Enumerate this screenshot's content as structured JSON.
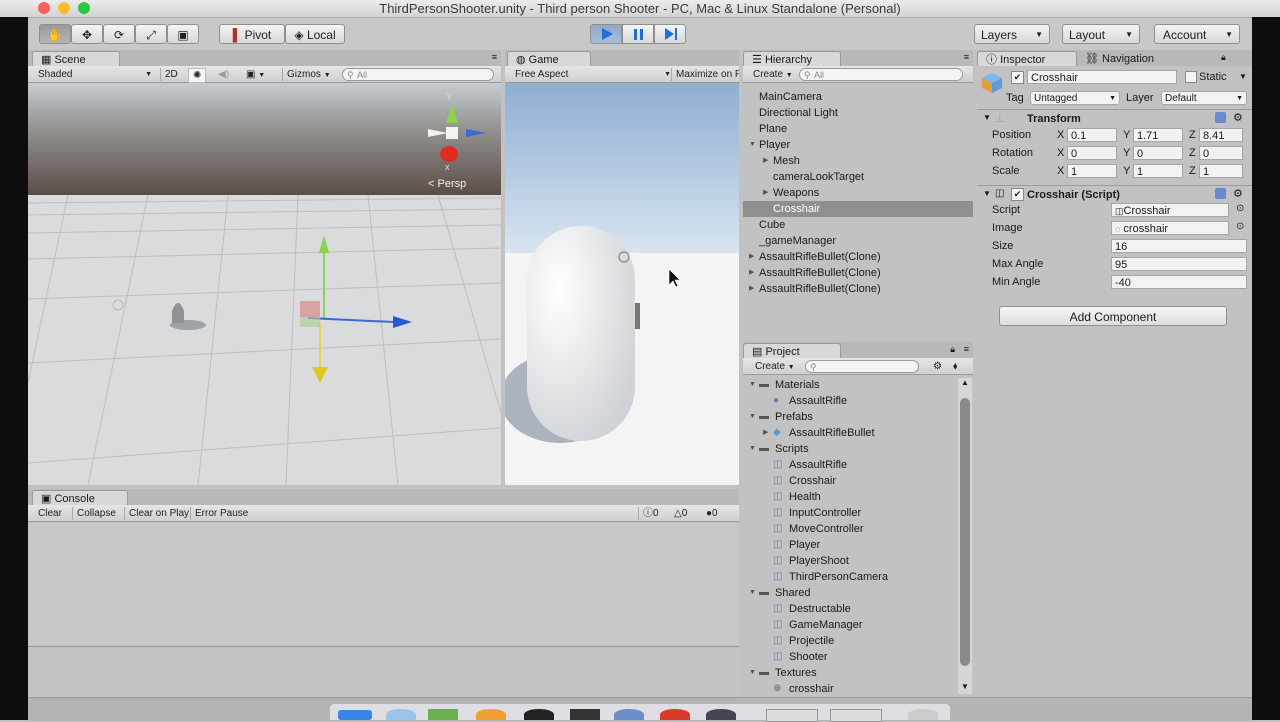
{
  "window": {
    "title": "ThirdPersonShooter.unity - Third person Shooter - PC, Mac & Linux Standalone (Personal)"
  },
  "toolbar": {
    "pivot": "Pivot",
    "local": "Local",
    "layers": "Layers",
    "layout": "Layout",
    "account": "Account"
  },
  "scene": {
    "tab": "Scene",
    "shading": "Shaded",
    "mode2d": "2D",
    "gizmos": "Gizmos",
    "search_placeholder": "All",
    "persp": "Persp",
    "axis_y": "y",
    "axis_x": "x"
  },
  "game": {
    "tab": "Game",
    "aspect": "Free Aspect",
    "maximize": "Maximize on P"
  },
  "hierarchy": {
    "tab": "Hierarchy",
    "create": "Create",
    "search_placeholder": "All",
    "items": [
      {
        "label": "MainCamera",
        "indent": 0,
        "arrow": ""
      },
      {
        "label": "Directional Light",
        "indent": 0,
        "arrow": ""
      },
      {
        "label": "Plane",
        "indent": 0,
        "arrow": ""
      },
      {
        "label": "Player",
        "indent": 0,
        "arrow": "open"
      },
      {
        "label": "Mesh",
        "indent": 1,
        "arrow": "closed"
      },
      {
        "label": "cameraLookTarget",
        "indent": 1,
        "arrow": ""
      },
      {
        "label": "Weapons",
        "indent": 1,
        "arrow": "closed"
      },
      {
        "label": "Crosshair",
        "indent": 1,
        "arrow": "",
        "selected": true
      },
      {
        "label": "Cube",
        "indent": 0,
        "arrow": ""
      },
      {
        "label": "_gameManager",
        "indent": 0,
        "arrow": ""
      },
      {
        "label": "AssaultRifleBullet(Clone)",
        "indent": 0,
        "arrow": "closed"
      },
      {
        "label": "AssaultRifleBullet(Clone)",
        "indent": 0,
        "arrow": "closed"
      },
      {
        "label": "AssaultRifleBullet(Clone)",
        "indent": 0,
        "arrow": "closed"
      }
    ]
  },
  "project": {
    "tab": "Project",
    "create": "Create",
    "items": [
      {
        "label": "Materials",
        "kind": "folder"
      },
      {
        "label": "AssaultRifle",
        "kind": "material"
      },
      {
        "label": "Prefabs",
        "kind": "folder"
      },
      {
        "label": "AssaultRifleBullet",
        "kind": "prefab"
      },
      {
        "label": "Scripts",
        "kind": "folder"
      },
      {
        "label": "AssaultRifle",
        "kind": "script"
      },
      {
        "label": "Crosshair",
        "kind": "script"
      },
      {
        "label": "Health",
        "kind": "script"
      },
      {
        "label": "InputController",
        "kind": "script"
      },
      {
        "label": "MoveController",
        "kind": "script"
      },
      {
        "label": "Player",
        "kind": "script"
      },
      {
        "label": "PlayerShoot",
        "kind": "script"
      },
      {
        "label": "ThirdPersonCamera",
        "kind": "script"
      },
      {
        "label": "Shared",
        "kind": "folder"
      },
      {
        "label": "Destructable",
        "kind": "script"
      },
      {
        "label": "GameManager",
        "kind": "script"
      },
      {
        "label": "Projectile",
        "kind": "script"
      },
      {
        "label": "Shooter",
        "kind": "script"
      },
      {
        "label": "Textures",
        "kind": "folder"
      },
      {
        "label": "crosshair",
        "kind": "texture"
      }
    ]
  },
  "console": {
    "tab": "Console",
    "clear": "Clear",
    "collapse": "Collapse",
    "clear_on_play": "Clear on Play",
    "error_pause": "Error Pause",
    "log_count": "0",
    "warn_count": "0",
    "error_count": "0"
  },
  "inspector": {
    "tab": "Inspector",
    "nav_tab": "Navigation",
    "object_name": "Crosshair",
    "static_label": "Static",
    "tag_label": "Tag",
    "tag_value": "Untagged",
    "layer_label": "Layer",
    "layer_value": "Default",
    "transform": {
      "title": "Transform",
      "position_label": "Position",
      "rotation_label": "Rotation",
      "scale_label": "Scale",
      "x": "X",
      "y": "Y",
      "z": "Z",
      "position": [
        "0.1",
        "1.71",
        "8.41"
      ],
      "rotation": [
        "0",
        "0",
        "0"
      ],
      "scale": [
        "1",
        "1",
        "1"
      ]
    },
    "script_component": {
      "title": "Crosshair (Script)",
      "script_label": "Script",
      "script_value": "Crosshair",
      "image_label": "Image",
      "image_value": "crosshair",
      "size_label": "Size",
      "size_value": "16",
      "max_angle_label": "Max Angle",
      "max_angle_value": "95",
      "min_angle_label": "Min Angle",
      "min_angle_value": "-40"
    },
    "add_component": "Add Component"
  }
}
